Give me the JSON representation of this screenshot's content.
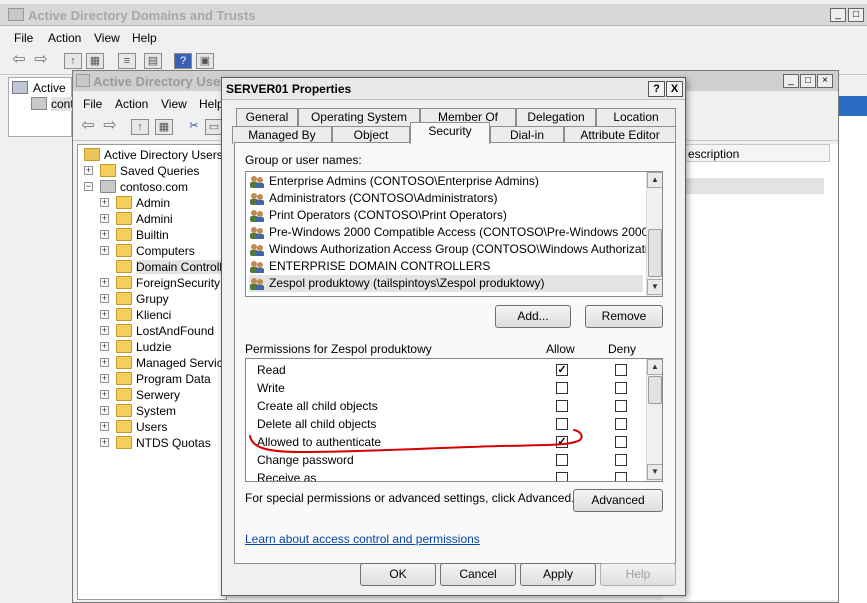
{
  "outer_window": {
    "title": "Active Directory Domains and Trusts",
    "menu": [
      "File",
      "Action",
      "View",
      "Help"
    ],
    "tree_root": "Active D",
    "tree_child": "conto"
  },
  "aduc_window": {
    "title": "Active Directory Users",
    "menu": [
      "File",
      "Action",
      "View",
      "Help"
    ],
    "tree": {
      "root": "Active Directory Users an",
      "saved_queries": "Saved Queries",
      "domain": "contoso.com",
      "items": [
        "Admin",
        "Admini",
        "Builtin",
        "Computers",
        "Domain Controller",
        "ForeignSecurityPr",
        "Grupy",
        "Klienci",
        "LostAndFound",
        "Ludzie",
        "Managed Service",
        "Program Data",
        "Serwery",
        "System",
        "Users",
        "NTDS Quotas"
      ]
    },
    "column_header": "escription"
  },
  "dialog": {
    "title": "SERVER01 Properties",
    "help_btn": "?",
    "close_btn": "X",
    "tabs_row1": [
      "General",
      "Operating System",
      "Member Of",
      "Delegation",
      "Location"
    ],
    "tabs_row2": [
      "Managed By",
      "Object",
      "Security",
      "Dial-in",
      "Attribute Editor"
    ],
    "active_tab": "Security",
    "group_label": "Group or user names:",
    "groups": [
      "Enterprise Admins (CONTOSO\\Enterprise Admins)",
      "Administrators (CONTOSO\\Administrators)",
      "Print Operators (CONTOSO\\Print Operators)",
      "Pre-Windows 2000 Compatible Access (CONTOSO\\Pre-Windows 2000 Com...",
      "Windows Authorization Access Group (CONTOSO\\Windows Authorization Ac...",
      "ENTERPRISE DOMAIN CONTROLLERS",
      "Zespol produktowy (tailspintoys\\Zespol produktowy)"
    ],
    "selected_group_index": 6,
    "add_button": "Add...",
    "remove_button": "Remove",
    "permissions_label": "Permissions for Zespol produktowy",
    "allow_header": "Allow",
    "deny_header": "Deny",
    "permissions": [
      {
        "name": "Read",
        "allow": true,
        "deny": false
      },
      {
        "name": "Write",
        "allow": false,
        "deny": false
      },
      {
        "name": "Create all child objects",
        "allow": false,
        "deny": false
      },
      {
        "name": "Delete all child objects",
        "allow": false,
        "deny": false
      },
      {
        "name": "Allowed to authenticate",
        "allow": true,
        "deny": false
      },
      {
        "name": "Change password",
        "allow": false,
        "deny": false
      },
      {
        "name": "Receive as",
        "allow": false,
        "deny": false
      }
    ],
    "special_text": "For special permissions or advanced settings, click Advanced.",
    "advanced_button": "Advanced",
    "learn_link": "Learn about access control and permissions",
    "ok_button": "OK",
    "cancel_button": "Cancel",
    "apply_button": "Apply",
    "help_button": "Help"
  },
  "colors": {
    "annotation_red": "#d40000",
    "link_blue": "#0645ad",
    "selection_gray": "#e3e3e3"
  }
}
